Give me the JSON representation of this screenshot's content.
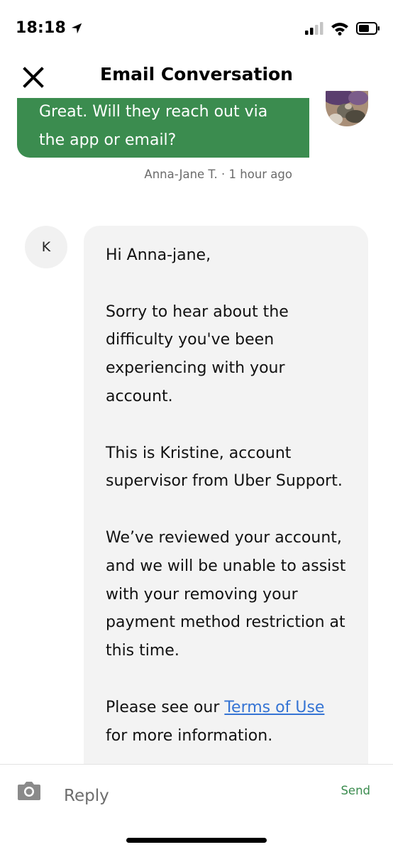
{
  "status_bar": {
    "time": "18:18",
    "icons": [
      "location-arrow-icon",
      "cellular-signal-icon",
      "wifi-icon",
      "battery-icon"
    ]
  },
  "header": {
    "title": "Email Conversation",
    "close_icon": "close-icon"
  },
  "messages": [
    {
      "direction": "outgoing",
      "lines": [
        "Great. Will they reach out via",
        "the app or email?"
      ],
      "meta": "Anna-Jane T. · 1 hour ago",
      "bubble_color": "#3b8c4f"
    },
    {
      "direction": "incoming",
      "avatar_initial": "K",
      "paragraphs": [
        [
          "Hi Anna-jane,"
        ],
        [
          "Sorry to hear about the",
          "difficulty you've been",
          "experiencing with your",
          "account."
        ],
        [
          "This is Kristine, account",
          "supervisor from Uber Support."
        ],
        [
          "We’ve reviewed your account,",
          "and we will be unable to assist",
          "with your removing your",
          "payment method restriction at",
          "this time."
        ]
      ],
      "closing": {
        "prefix": "Please see our ",
        "link_text": "Terms of Use",
        "suffix": "for more information."
      },
      "bubble_color": "#f3f3f3",
      "link_color": "#3574d4"
    }
  ],
  "reply_bar": {
    "placeholder": "Reply",
    "send_label": "Send",
    "camera_icon": "camera-icon",
    "accent_color": "#3b8c4f"
  }
}
